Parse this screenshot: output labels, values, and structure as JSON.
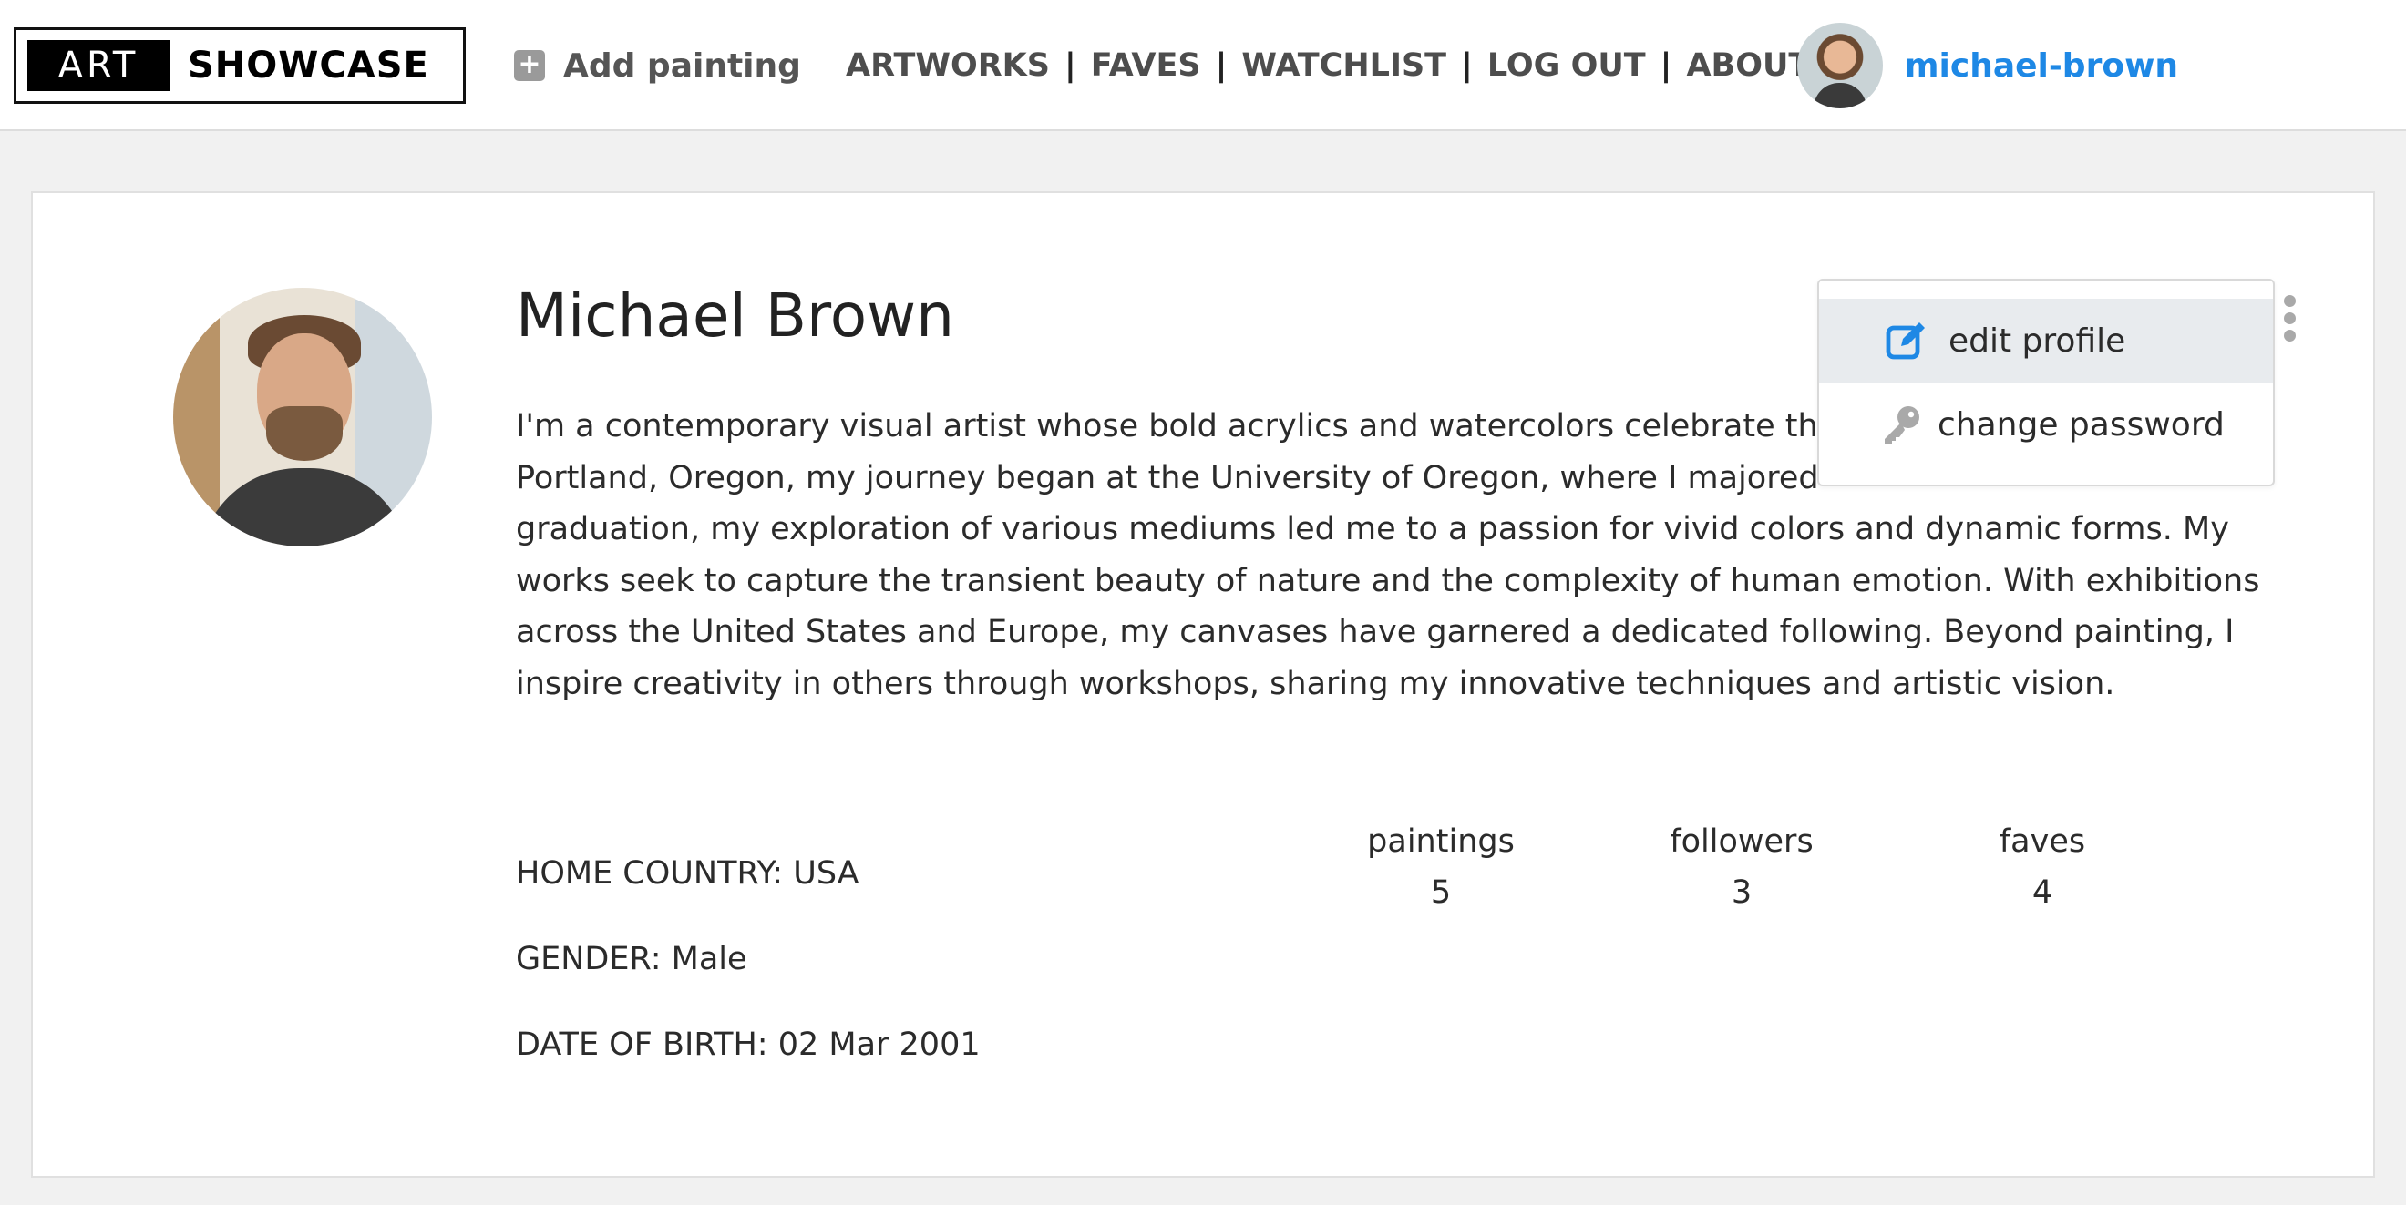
{
  "header": {
    "logo": {
      "part1": "ART",
      "part2": "SHOWCASE"
    },
    "add_painting_label": "Add painting",
    "nav": [
      {
        "label": "ARTWORKS"
      },
      {
        "label": "FAVES"
      },
      {
        "label": "WATCHLIST"
      },
      {
        "label": "LOG OUT"
      },
      {
        "label": "ABOUT"
      }
    ],
    "nav_separator": "|",
    "username": "michael-brown"
  },
  "profile": {
    "name": "Michael Brown",
    "bio": "I'm a contemporary visual artist whose bold acrylics and watercolors celebrate th",
    "bio_line2": "Portland, Oregon, my journey began at the University of Oregon, where I majored",
    "bio_rest": "graduation, my exploration of various mediums led me to a passion for vivid colors and dynamic forms. My works seek to capture the transient beauty of nature and the complexity of human emotion. With exhibitions across the United States and Europe, my canvases have garnered a dedicated following. Beyond painting, I inspire creativity in others through workshops, sharing my innovative techniques and artistic vision.",
    "details": [
      "HOME COUNTRY: USA",
      "GENDER: Male",
      "DATE OF BIRTH: 02 Mar 2001"
    ],
    "stats": [
      {
        "label": "paintings",
        "value": "5"
      },
      {
        "label": "followers",
        "value": "3"
      },
      {
        "label": "faves",
        "value": "4"
      }
    ]
  },
  "menu": {
    "items": [
      {
        "label": "edit profile",
        "icon": "edit-icon"
      },
      {
        "label": "change password",
        "icon": "key-icon"
      }
    ]
  },
  "colors": {
    "accent": "#1e88e5",
    "menu_active_bg": "#e8ebee"
  }
}
